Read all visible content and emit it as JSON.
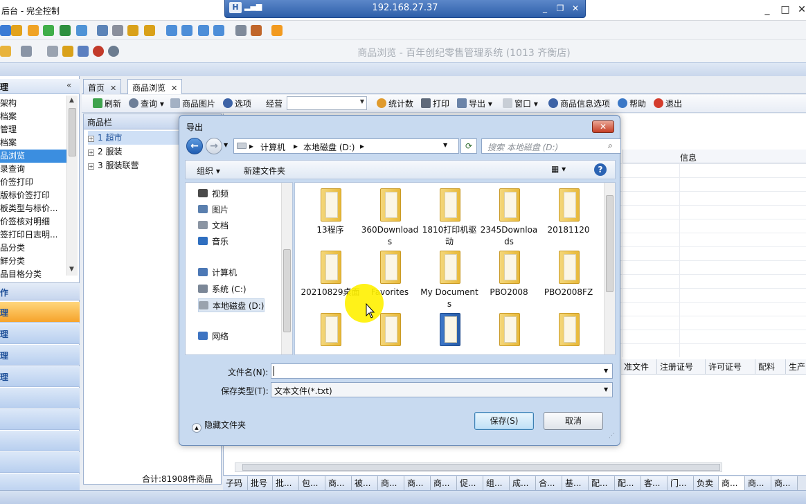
{
  "window": {
    "title": "后台 - 完全控制",
    "min_glyph": "_",
    "max_glyph": "□",
    "close_glyph": "✕"
  },
  "remote": {
    "ip": "192.168.27.37",
    "pin_glyph": "H",
    "min_glyph": "_",
    "restore_glyph": "❐",
    "close_glyph": "✕"
  },
  "app_title": "商品浏览 - 百年创纪零售管理系统 (1013 齐衡店)",
  "leftnav": {
    "header": "理",
    "collapse_glyph": "«",
    "items": [
      "架构",
      "档案",
      "管理",
      "档案",
      "品浏览",
      "录查询",
      "价签打印",
      "版标价签打印",
      "板类型与标价...",
      "价签核对明细",
      "签打印日志明...",
      "品分类",
      "鲜分类",
      "品目格分类"
    ],
    "selected_index": 4,
    "ops_header": "作",
    "op_rows": [
      "理",
      "理",
      "理",
      "理",
      "",
      "",
      "",
      "",
      ""
    ]
  },
  "tabs": [
    {
      "label": "首页",
      "close": "✕"
    },
    {
      "label": "商品浏览",
      "close": "✕"
    }
  ],
  "toolbar": {
    "refresh": "刷新",
    "query": "查询",
    "product_image": "商品图片",
    "options": "选项",
    "manager_label": "经营",
    "manager_value": "",
    "stats": "统计数",
    "print": "打印",
    "export": "导出",
    "window": "窗口",
    "product_info_options": "商品信息选项",
    "help": "帮助",
    "exit": "退出"
  },
  "product_panel": {
    "header": "商品栏",
    "tree": [
      {
        "label": "1 超市",
        "selected": true
      },
      {
        "label": "2 服装",
        "selected": false
      },
      {
        "label": "3 服装联营",
        "selected": false
      }
    ],
    "total": "合计:81908件商品"
  },
  "grid": {
    "info_header": "信息",
    "columns": [
      "准文件",
      "注册证号",
      "许可证号",
      "配料",
      "生产"
    ]
  },
  "bottom_tabs": [
    "子码",
    "批号",
    "批...",
    "包...",
    "商...",
    "被...",
    "商...",
    "商...",
    "商...",
    "促...",
    "组...",
    "成...",
    "合...",
    "基...",
    "配...",
    "配...",
    "客...",
    "门...",
    "负卖",
    "商...",
    "商...",
    "商..."
  ],
  "bottom_active_index": 19,
  "dialog": {
    "title": "导出",
    "close": "✕",
    "breadcrumbs": [
      "计算机",
      "本地磁盘 (D:)"
    ],
    "search_placeholder": "搜索 本地磁盘 (D:)",
    "organize": "组织",
    "new_folder": "新建文件夹",
    "nav_items": [
      {
        "label": "视频",
        "color": "#4a4a4a"
      },
      {
        "label": "图片",
        "color": "#5a7fae"
      },
      {
        "label": "文档",
        "color": "#8b95a3"
      },
      {
        "label": "音乐",
        "color": "#2f6fc0"
      },
      {
        "label": "计算机",
        "color": "#4c78b5"
      },
      {
        "label": "系统 (C:)",
        "color": "#7b8797"
      },
      {
        "label": "本地磁盘 (D:)",
        "color": "#9aa3ae"
      },
      {
        "label": "网络",
        "color": "#3d74c2"
      }
    ],
    "selected_nav_index": 6,
    "folders": [
      "13程序",
      "360Downloads",
      "1810打印机驱动",
      "2345Downloads",
      "20181120",
      "20210829桌面",
      "Favorites",
      "My Documents",
      "PBO2008",
      "PBO2008FZ",
      "",
      "",
      "",
      "",
      ""
    ],
    "filename_label": "文件名(N):",
    "filename_value": "",
    "filetype_label": "保存类型(T):",
    "filetype_value": "文本文件(*.txt)",
    "hide_folders": "隐藏文件夹",
    "save": "保存(S)",
    "cancel": "取消"
  }
}
